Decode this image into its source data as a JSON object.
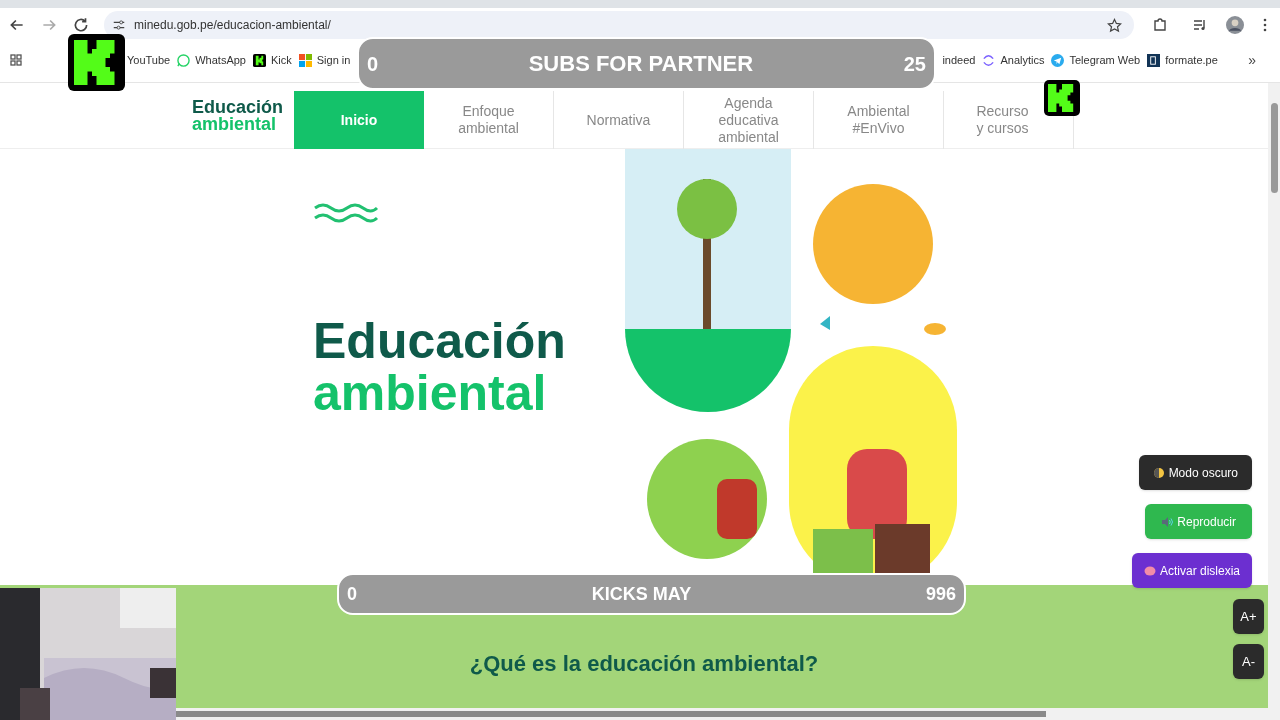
{
  "browser": {
    "url": "minedu.gob.pe/educacion-ambiental/",
    "bookmarks": [
      {
        "label": "YouTube"
      },
      {
        "label": "WhatsApp"
      },
      {
        "label": "Kick"
      },
      {
        "label": "Sign in"
      },
      {
        "label": "indeed"
      },
      {
        "label": "Analytics"
      },
      {
        "label": "Telegram Web"
      },
      {
        "label": "formate.pe"
      }
    ],
    "more": "»"
  },
  "site": {
    "logo": [
      "Educación",
      "ambiental"
    ],
    "nav": [
      {
        "label": "Inicio",
        "selected": true
      },
      {
        "label": "Enfoque ambiental",
        "selected": false
      },
      {
        "label": "Normativa",
        "selected": false
      },
      {
        "label": "Agenda educativa ambiental",
        "selected": false
      },
      {
        "label": "Ambiental #EnVivo",
        "selected": false
      },
      {
        "label": "Recurso y cursos",
        "selected": false
      }
    ],
    "hero_title": [
      "Educación",
      "ambiental"
    ],
    "section_heading": "¿Qué es la educación ambiental?",
    "accessibility": [
      {
        "label": "Modo oscuro",
        "kind": "dark"
      },
      {
        "label": "Reproducir",
        "kind": "audio"
      },
      {
        "label": "Activar dislexia",
        "kind": "dyslexia"
      }
    ],
    "font_size": [
      "A+",
      "A-"
    ]
  },
  "overlay": {
    "goals": [
      {
        "title": "SUBS FOR PARTNER",
        "start": "0",
        "end": "25"
      },
      {
        "title": "KICKS MAY",
        "start": "0",
        "end": "996"
      }
    ]
  }
}
